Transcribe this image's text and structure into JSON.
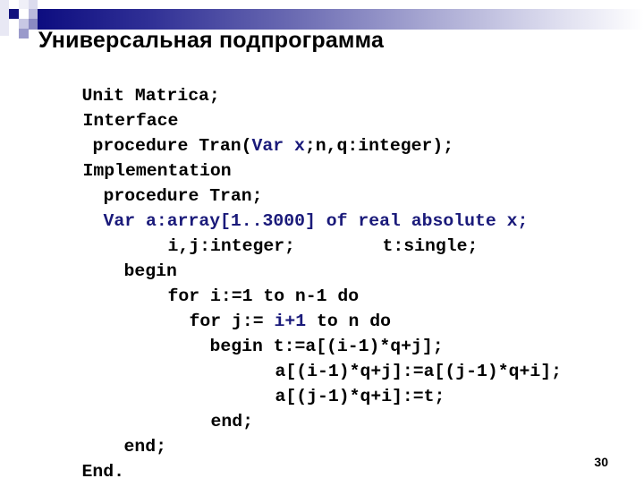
{
  "slide": {
    "title": "Универсальная подпрограмма",
    "page_number": "30",
    "colors": {
      "header_gradient_start": "#0d0d80",
      "header_gradient_end": "#ffffff",
      "highlight_code": "#1a1a7a",
      "text": "#000000"
    }
  },
  "code": {
    "lines": [
      {
        "segments": [
          "Unit Matrica;"
        ]
      },
      {
        "segments": [
          "Interface"
        ]
      },
      {
        "segments": [
          "procedure Tran(",
          "Var x",
          ";n,q:integer);"
        ]
      },
      {
        "segments": [
          "Implementation"
        ]
      },
      {
        "segments": [
          "procedure Tran;"
        ]
      },
      {
        "segments": [
          "Var a:array[1..3000] of real absolute x;"
        ]
      },
      {
        "segments": [
          "i,j:integer;",
          "t:single;"
        ]
      },
      {
        "segments": [
          "begin"
        ]
      },
      {
        "segments": [
          "for i:=1 to n-1 do"
        ]
      },
      {
        "segments": [
          "for j:= ",
          "i+1",
          " to n do"
        ]
      },
      {
        "segments": [
          "begin t:=a[(i-1)*q+j];"
        ]
      },
      {
        "segments": [
          "a[(i-1)*q+j]:=a[(j-1)*q+i];"
        ]
      },
      {
        "segments": [
          "a[(j-1)*q+i]:=t;"
        ]
      },
      {
        "segments": [
          "end;"
        ]
      },
      {
        "segments": [
          "end;"
        ]
      },
      {
        "segments": [
          "End."
        ]
      }
    ]
  }
}
